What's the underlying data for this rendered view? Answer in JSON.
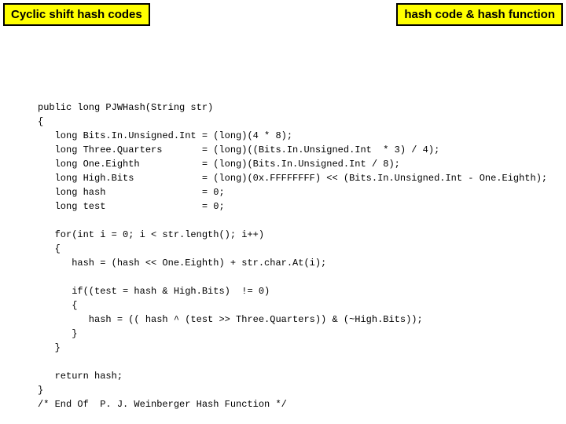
{
  "header": {
    "left_label": "Cyclic shift hash codes",
    "right_label": "hash code & hash function"
  },
  "code": {
    "line01": "public long PJWHash(String str)",
    "line02": "{",
    "line03": "   long Bits.In.Unsigned.Int = (long)(4 * 8);",
    "line04": "   long Three.Quarters       = (long)((Bits.In.Unsigned.Int  * 3) / 4);",
    "line05": "   long One.Eighth           = (long)(Bits.In.Unsigned.Int / 8);",
    "line06": "   long High.Bits            = (long)(0x.FFFFFFFF) << (Bits.In.Unsigned.Int - One.Eighth);",
    "line07": "   long hash                 = 0;",
    "line08": "   long test                 = 0;",
    "line09": "",
    "line10": "   for(int i = 0; i < str.length(); i++)",
    "line11": "   {",
    "line12": "      hash = (hash << One.Eighth) + str.char.At(i);",
    "line13": "",
    "line14": "      if((test = hash & High.Bits)  != 0)",
    "line15": "      {",
    "line16": "         hash = (( hash ^ (test >> Three.Quarters)) & (~High.Bits));",
    "line17": "      }",
    "line18": "   }",
    "line19": "",
    "line20": "   return hash;",
    "line21": "}",
    "line22": "/* End Of  P. J. Weinberger Hash Function */"
  }
}
